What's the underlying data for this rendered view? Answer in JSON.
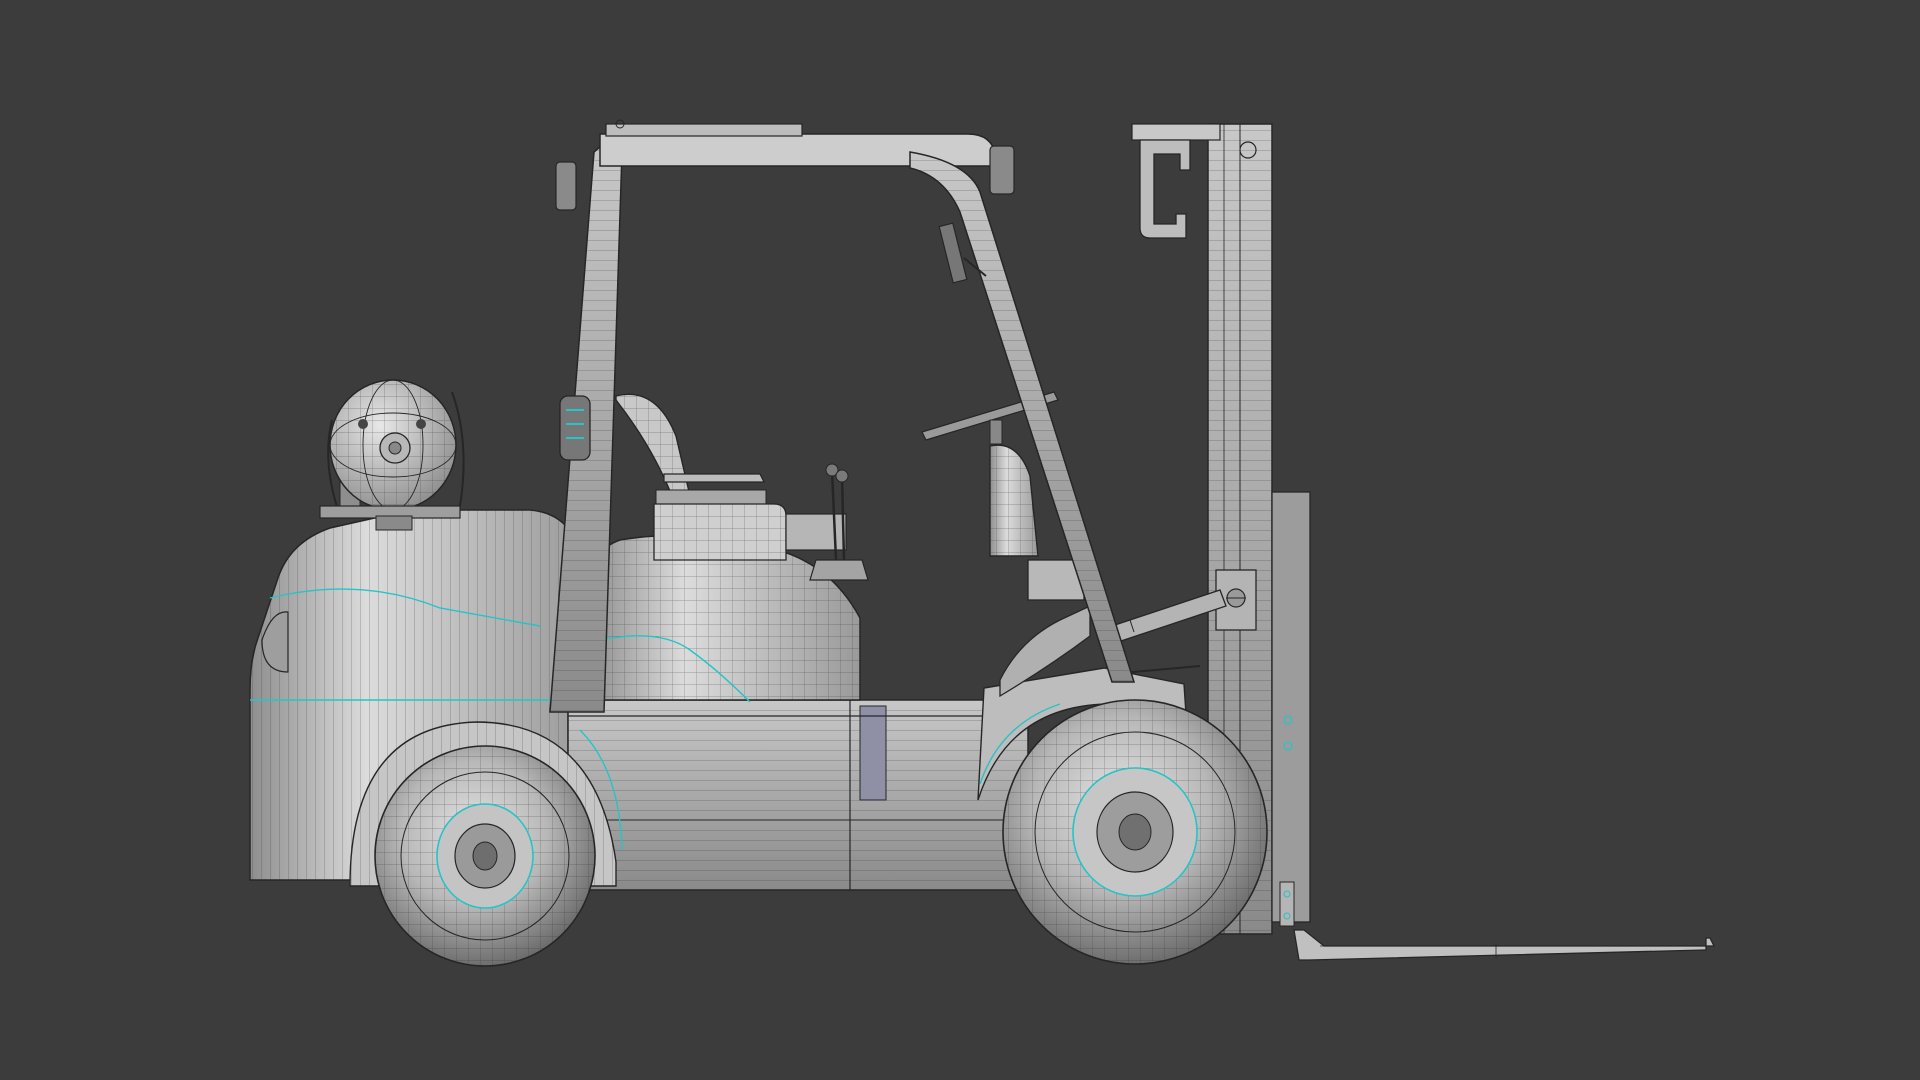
{
  "scene": {
    "subject": "forklift-wireframe-side-view",
    "colors": {
      "background": "#3c3c3c",
      "body_light": "#d6d6d6",
      "body_mid": "#a9a9a9",
      "body_dark": "#7e7e7e",
      "wire": "#262626",
      "accent": "#27c3c7",
      "glass": "#8f8fa6"
    }
  }
}
